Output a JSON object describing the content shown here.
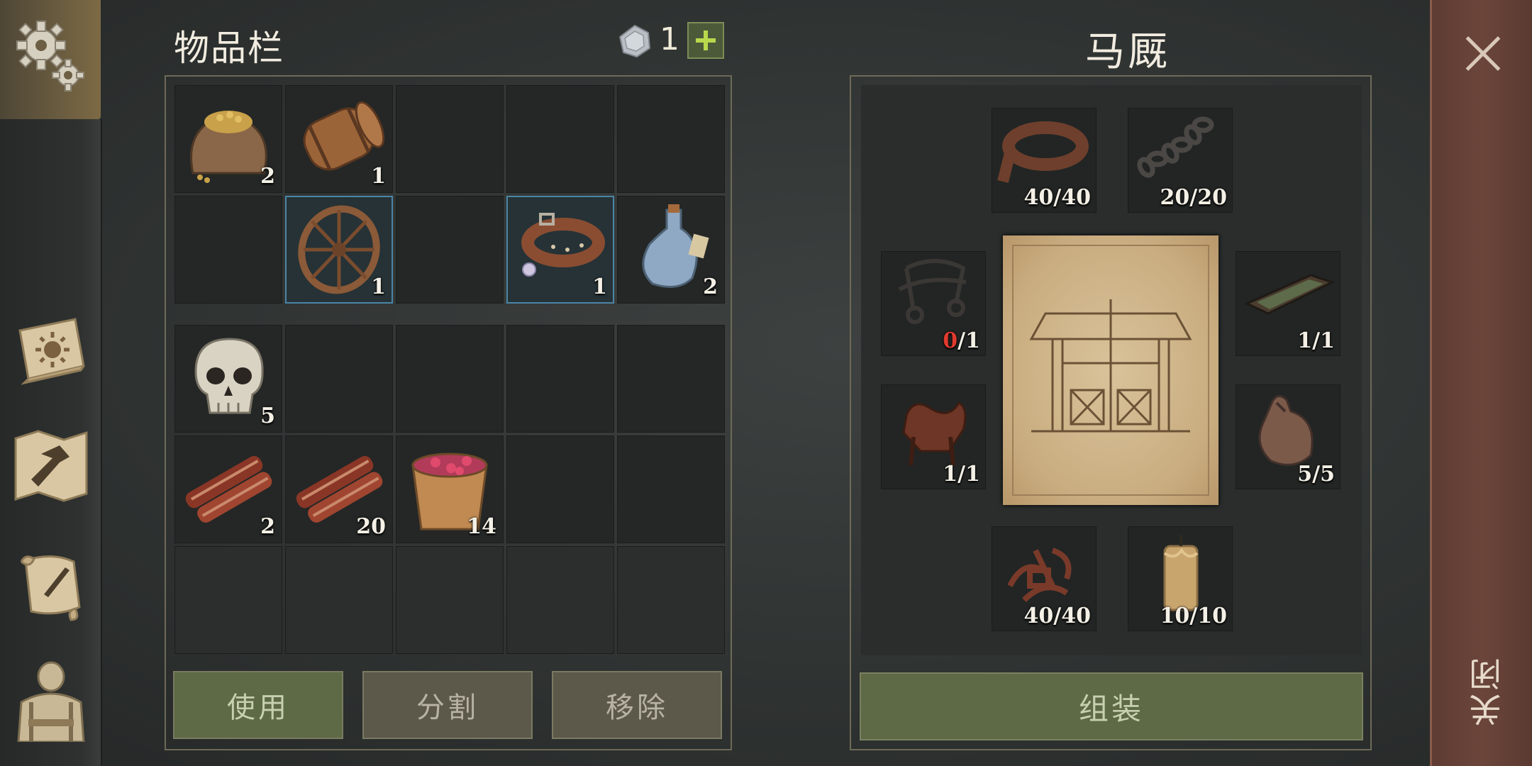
{
  "inventory": {
    "title": "物品栏",
    "coins": "1",
    "add_label": "+",
    "slots": [
      {
        "item": "grain-sack",
        "qty": "2"
      },
      {
        "item": "barrel",
        "qty": "1"
      },
      {
        "item": null,
        "qty": ""
      },
      {
        "item": null,
        "qty": ""
      },
      {
        "item": null,
        "qty": ""
      },
      {
        "item": null,
        "qty": ""
      },
      {
        "item": "wheel",
        "qty": "1"
      },
      {
        "item": null,
        "qty": ""
      },
      {
        "item": "collar",
        "qty": "1"
      },
      {
        "item": "potion",
        "qty": "2"
      },
      {
        "item": "skull",
        "qty": "5"
      },
      {
        "item": null,
        "qty": ""
      },
      {
        "item": null,
        "qty": ""
      },
      {
        "item": null,
        "qty": ""
      },
      {
        "item": null,
        "qty": ""
      },
      {
        "item": "meat",
        "qty": "2"
      },
      {
        "item": "meat",
        "qty": "20"
      },
      {
        "item": "berry-bucket",
        "qty": "14"
      },
      {
        "item": null,
        "qty": ""
      },
      {
        "item": null,
        "qty": ""
      },
      {
        "item": null,
        "qty": ""
      },
      {
        "item": null,
        "qty": ""
      },
      {
        "item": null,
        "qty": ""
      },
      {
        "item": null,
        "qty": ""
      },
      {
        "item": null,
        "qty": ""
      }
    ],
    "buttons": {
      "use": "使用",
      "split": "分割",
      "remove": "移除"
    }
  },
  "stable": {
    "title": "马厩",
    "materials": [
      {
        "name": "leather-strap",
        "have": "40",
        "need": "/40"
      },
      {
        "name": "chain",
        "have": "20",
        "need": "/20"
      },
      {
        "name": "bridle",
        "have": "0",
        "need": "/1",
        "missing": true
      },
      {
        "name": "trough",
        "have": "1",
        "need": "/1"
      },
      {
        "name": "saddle",
        "have": "1",
        "need": "/1"
      },
      {
        "name": "feed-sack",
        "have": "5",
        "need": "/5"
      },
      {
        "name": "leather-scraps",
        "have": "40",
        "need": "/40"
      },
      {
        "name": "candle",
        "have": "10",
        "need": "/10"
      }
    ],
    "assemble_label": "组装"
  },
  "close_label": "关闭",
  "colors": {
    "accent_green": "#5d6a45",
    "missing_red": "#e03a2e",
    "close_strip": "#6b453a"
  }
}
